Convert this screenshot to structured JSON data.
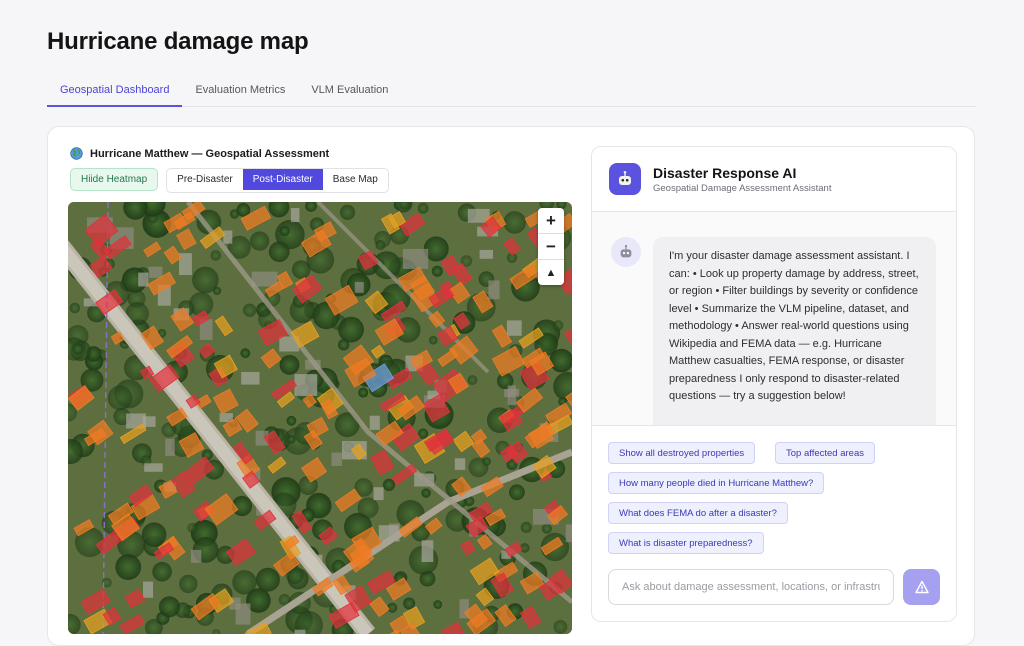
{
  "page": {
    "title": "Hurricane damage map"
  },
  "tabs": [
    {
      "label": "Geospatial Dashboard",
      "active": true
    },
    {
      "label": "Evaluation Metrics",
      "active": false
    },
    {
      "label": "VLM Evaluation",
      "active": false
    }
  ],
  "map_panel": {
    "title": "Hurricane Matthew — Geospatial Assessment",
    "heatmap_button": "Hiide Heatmap",
    "layers": [
      {
        "label": "Pre-Disaster",
        "active": false
      },
      {
        "label": "Post-Disaster",
        "active": true
      },
      {
        "label": "Base Map",
        "active": false
      }
    ],
    "zoom": {
      "in": "+",
      "out": "−",
      "reset": "▲"
    }
  },
  "chat": {
    "title": "Disaster Response AI",
    "subtitle": "Geospatial Damage Assessment Assistant",
    "message": "I'm your disaster damage assessment assistant. I can: • Look up property damage by address, street, or region • Filter buildings by severity or confidence level • Summarize the VLM pipeline, dataset, and methodology • Answer real-world questions using Wikipedia and FEMA data — e.g. Hurricane Matthew casualties, FEMA response, or disaster preparedness I only respond to disaster-related questions — try a suggestion below!",
    "suggestions": [
      "Show all destroyed properties",
      "Top affected areas",
      "How many people died in Hurricane Matthew?",
      "What does FEMA do after a disaster?",
      "What is disaster preparedness?"
    ],
    "input_placeholder": "Ask about damage assessment, locations, or infrastructure...",
    "input_value": ""
  },
  "colors": {
    "accent": "#5b53e0",
    "destroyed": "#e0323c",
    "major_damage": "#f07b22",
    "minor_damage": "#e8a020",
    "no_damage": "#6f9fe0"
  },
  "icons": {
    "map_header": "globe-icon",
    "assistant": "robot-icon",
    "send": "send-icon"
  }
}
